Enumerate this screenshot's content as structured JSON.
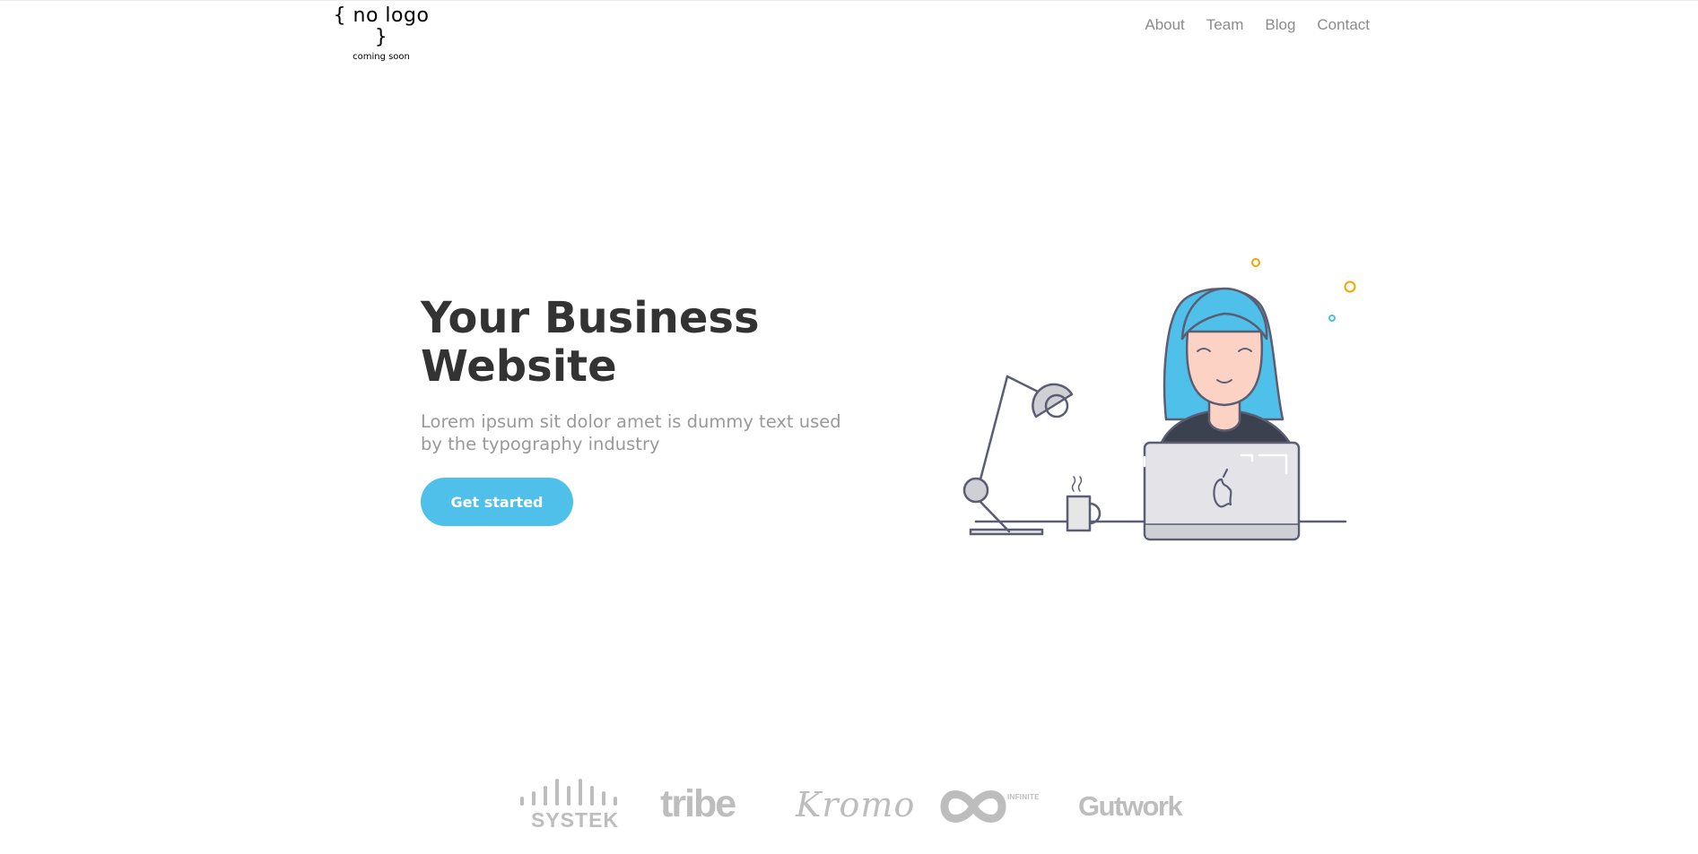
{
  "header": {
    "logo_text": "{ no logo }",
    "logo_tagline": "coming soon",
    "nav": [
      {
        "label": "About"
      },
      {
        "label": "Team"
      },
      {
        "label": "Blog"
      },
      {
        "label": "Contact"
      }
    ]
  },
  "hero": {
    "title_line1": "Your Business",
    "title_line2": "Website",
    "subtitle_line1": "Lorem ipsum sit dolor amet is dummy text used",
    "subtitle_line2": "by the typography industry",
    "cta_label": "Get started",
    "illustration_icon": "woman-at-laptop-illustration"
  },
  "brands": {
    "items": [
      {
        "name": "SYSTEK"
      },
      {
        "name": "tribe"
      },
      {
        "name": "Kromo"
      },
      {
        "name": "INFINITE"
      },
      {
        "name": "Gutwork"
      }
    ]
  },
  "colors": {
    "accent": "#4ec0ea",
    "heading": "#333333",
    "muted_text": "#999999",
    "nav_text": "#8c8c8c",
    "brand_gray": "#bdbdbd",
    "line_art": "#5b5d73",
    "skin": "#fbd2c4",
    "sparkle_orange": "#f2a400"
  }
}
